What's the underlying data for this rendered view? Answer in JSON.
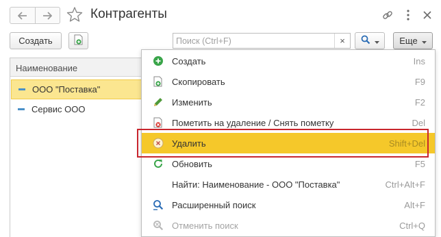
{
  "header": {
    "title": "Контрагенты"
  },
  "toolbar": {
    "create_label": "Создать",
    "search_placeholder": "Поиск (Ctrl+F)",
    "search_clear": "×",
    "more_label": "Еще"
  },
  "table": {
    "column_header": "Наименование",
    "rows": [
      {
        "name": "ООО \"Поставка\"",
        "selected": true
      },
      {
        "name": "Сервис ООО",
        "selected": false
      }
    ]
  },
  "menu": {
    "items": [
      {
        "label": "Создать",
        "shortcut": "Ins",
        "icon": "plus-circle-icon"
      },
      {
        "label": "Скопировать",
        "shortcut": "F9",
        "icon": "copy-doc-icon"
      },
      {
        "label": "Изменить",
        "shortcut": "F2",
        "icon": "pencil-icon"
      },
      {
        "label": "Пометить на удаление / Снять пометку",
        "shortcut": "Del",
        "icon": "mark-delete-icon"
      },
      {
        "label": "Удалить",
        "shortcut": "Shift+Del",
        "icon": "delete-circle-icon",
        "active": true
      },
      {
        "label": "Обновить",
        "shortcut": "F5",
        "icon": "refresh-icon"
      },
      {
        "label": "Найти: Наименование - ООО \"Поставка\"",
        "shortcut": "Ctrl+Alt+F",
        "icon": ""
      },
      {
        "label": "Расширенный поиск",
        "shortcut": "Alt+F",
        "icon": "advanced-search-icon"
      },
      {
        "label": "Отменить поиск",
        "shortcut": "Ctrl+Q",
        "icon": "cancel-search-icon",
        "disabled": true
      }
    ]
  },
  "colors": {
    "accent_yellow": "#f5c82a",
    "selection_yellow": "#fbe690",
    "highlight_red": "#c8252d",
    "green": "#3aa54a",
    "blue": "#2a6cb5"
  }
}
